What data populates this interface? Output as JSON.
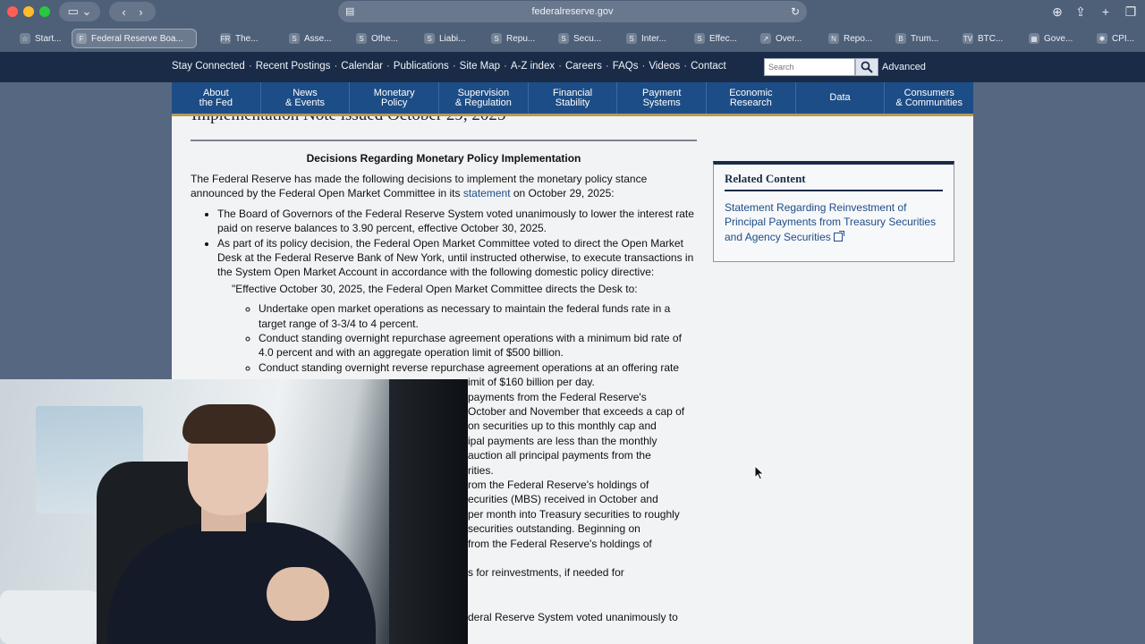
{
  "browser": {
    "url": "federalreserve.gov",
    "tabs": [
      {
        "icon": "☆",
        "label": "Start..."
      },
      {
        "icon": "F",
        "label": "Federal Reserve Boa..."
      },
      {
        "icon": "FR",
        "label": "The..."
      },
      {
        "icon": "S",
        "label": "Asse..."
      },
      {
        "icon": "S",
        "label": "Othe..."
      },
      {
        "icon": "S",
        "label": "Liabi..."
      },
      {
        "icon": "S",
        "label": "Repu..."
      },
      {
        "icon": "S",
        "label": "Secu..."
      },
      {
        "icon": "S",
        "label": "Inter..."
      },
      {
        "icon": "S",
        "label": "Effec..."
      },
      {
        "icon": "↗",
        "label": "Over..."
      },
      {
        "icon": "N",
        "label": "Repo..."
      },
      {
        "icon": "B",
        "label": "Trum..."
      },
      {
        "icon": "TV",
        "label": "BTC..."
      },
      {
        "icon": "▦",
        "label": "Gove..."
      },
      {
        "icon": "✱",
        "label": "CPI..."
      }
    ]
  },
  "utility_nav": [
    "Stay Connected",
    "Recent Postings",
    "Calendar",
    "Publications",
    "Site Map",
    "A-Z index",
    "Careers",
    "FAQs",
    "Videos",
    "Contact"
  ],
  "utility_sep": "·",
  "search": {
    "placeholder": "Search",
    "advanced": "Advanced"
  },
  "main_nav": [
    "About\nthe Fed",
    "News\n& Events",
    "Monetary\nPolicy",
    "Supervision\n& Regulation",
    "Financial\nStability",
    "Payment\nSystems",
    "Economic\nResearch",
    "Data",
    "Consumers\n& Communities"
  ],
  "article": {
    "partial_heading": "Implementation Note issued October 29, 2025",
    "title": "Decisions Regarding Monetary Policy Implementation",
    "intro_before": "The Federal Reserve has made the following decisions to implement the monetary policy stance announced by the Federal Open Market Committee in its ",
    "intro_link": "statement",
    "intro_after": " on October 29, 2025:",
    "bullet1": "The Board of Governors of the Federal Reserve System voted unanimously to lower the interest rate paid on reserve balances to 3.90 percent, effective October 30, 2025.",
    "bullet2": "As part of its policy decision, the Federal Open Market Committee voted to direct the Open Market Desk at the Federal Reserve Bank of New York, until instructed otherwise, to execute transactions in the System Open Market Account in accordance with the following domestic policy directive:",
    "quote": "\"Effective October 30, 2025, the Federal Open Market Committee directs the Desk to:",
    "sub1": "Undertake open market operations as necessary to maintain the federal funds rate in a target range of 3-3/4 to 4 percent.",
    "sub2": "Conduct standing overnight repurchase agreement operations with a minimum bid rate of 4.0 percent and with an aggregate operation limit of $500 billion.",
    "sub3": "Conduct standing overnight reverse repurchase agreement operations at an offering rate",
    "visible_fragments": [
      "imit of $160 billion per day.",
      "payments from the Federal Reserve's",
      "October and November that exceeds a cap of",
      "on securities up to this monthly cap and",
      "ipal payments are less than the monthly",
      "auction all principal payments from the",
      "rities.",
      "rom the Federal Reserve's holdings of",
      "ecurities (MBS) received in October and",
      "per month into Treasury securities to roughly",
      "securities outstanding. Beginning on",
      "from the Federal Reserve's holdings of",
      "",
      "s for reinvestments, if needed for",
      "",
      "",
      "deral Reserve System voted unanimously to"
    ]
  },
  "related": {
    "heading": "Related Content",
    "link": "Statement Regarding Reinvestment of Principal Payments from Treasury Securities and Agency Securities"
  },
  "colors": {
    "site_header": "#1a2b48",
    "nav_blue": "#1d4d86",
    "accent_gold": "#b59a56"
  }
}
